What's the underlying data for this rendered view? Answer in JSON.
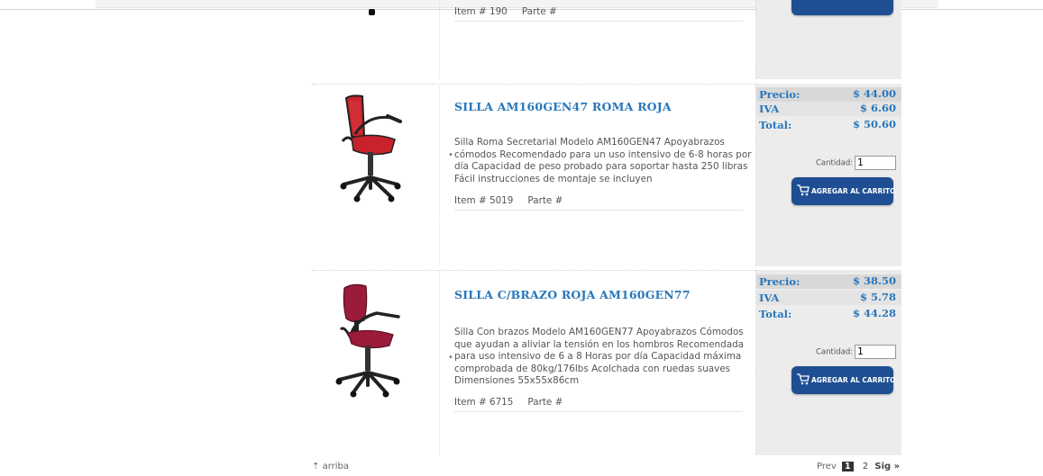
{
  "products": [
    {
      "title": "",
      "desc_lines": [],
      "item_label": "Item # 190",
      "part_label": "Parte #"
    },
    {
      "title": "SILLA AM160GEN47 ROMA ROJA",
      "desc_lines": [
        "Silla Roma Secretarial Modelo AM160GEN47 Apoyabrazos",
        "cómodos Recomendado para un uso intensivo de 6-8 horas por",
        "día Capacidad de peso probado para soportar hasta 250 libras",
        "Fácil instrucciones de montaje se incluyen"
      ],
      "item_label": "Item # 5019",
      "part_label": "Parte #",
      "precio_label": "Precio:",
      "precio": "$ 44.00",
      "iva_label": "IVA",
      "iva": "$ 6.60",
      "total_label": "Total:",
      "total": "$ 50.60",
      "cantidad_label": "Cantidad:",
      "cantidad": "1",
      "cart_label": "AGREGAR AL CARRITO"
    },
    {
      "title": "SILLA C/BRAZO ROJA AM160GEN77",
      "desc_lines": [
        "Silla Con brazos Modelo AM160GEN77 Apoyabrazos Cómodos",
        "que ayudan a aliviar la tensión en los hombros Recomendada",
        "para uso intensivo de 6 a 8 Horas por día Capacidad máxima",
        "comprobada de 80kg/176lbs Acolchada con ruedas suaves",
        "Dimensiones 55x55x86cm"
      ],
      "item_label": "Item # 6715",
      "part_label": "Parte #",
      "precio_label": "Precio:",
      "precio": "$ 38.50",
      "iva_label": "IVA",
      "iva": "$ 5.78",
      "total_label": "Total:",
      "total": "$ 44.28",
      "cantidad_label": "Cantidad:",
      "cantidad": "1",
      "cart_label": "AGREGAR AL CARRITO"
    }
  ],
  "footer": {
    "arriba_icon": "up-arrow-icon",
    "arriba": "arriba",
    "prev": "Prev",
    "current_page": "1",
    "next_page": "2",
    "sig": "Sig »"
  },
  "colors": {
    "title_blue": "#2877bb",
    "button_blue": "#1f4f92",
    "price_panel": "#ececec",
    "chair_red": "#c8232c",
    "chair_maroon": "#9a1b3a"
  }
}
